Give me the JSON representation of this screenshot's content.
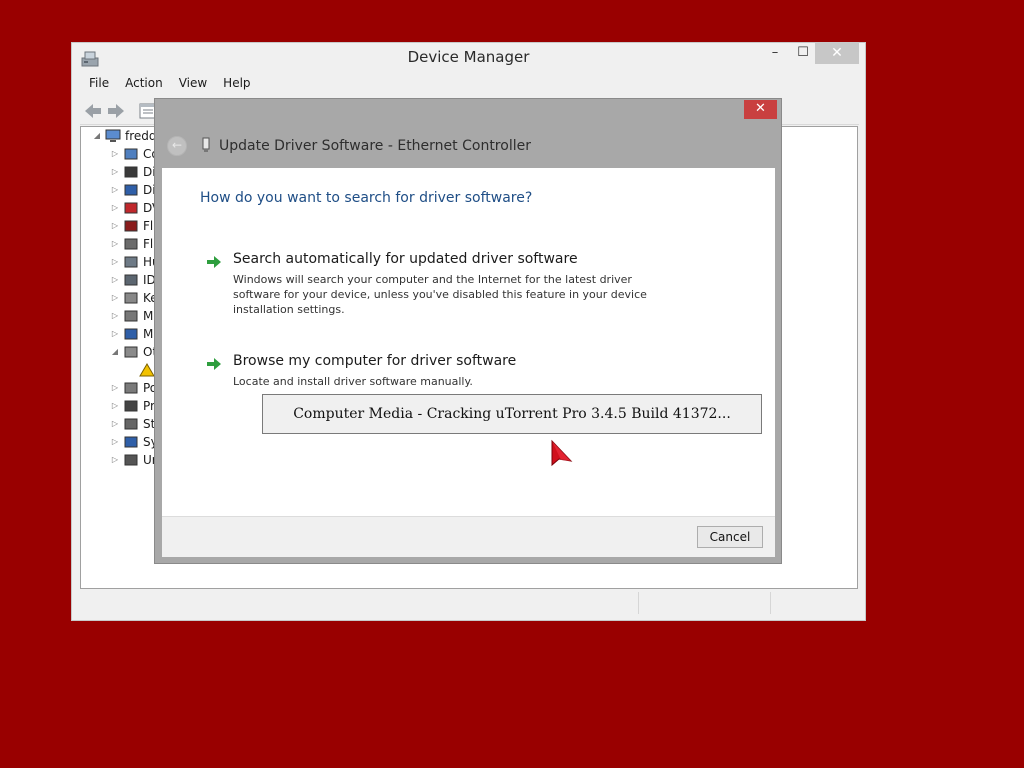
{
  "device_manager": {
    "title": "Device Manager",
    "window_buttons": {
      "minimize": "–",
      "maximize": "☐",
      "close": "✕"
    },
    "menu": [
      "File",
      "Action",
      "View",
      "Help"
    ],
    "tree": {
      "root": {
        "label": "fredd",
        "expanded": true
      },
      "items": [
        {
          "label": "Co",
          "icon": "computer-icon"
        },
        {
          "label": "Di",
          "icon": "disk-drive-icon"
        },
        {
          "label": "Di",
          "icon": "display-adapter-icon"
        },
        {
          "label": "DV",
          "icon": "dvd-drive-icon"
        },
        {
          "label": "Fl",
          "icon": "floppy-controller-icon"
        },
        {
          "label": "Fl",
          "icon": "floppy-drive-icon"
        },
        {
          "label": "Hu",
          "icon": "hid-icon"
        },
        {
          "label": "ID",
          "icon": "ide-controller-icon"
        },
        {
          "label": "Ke",
          "icon": "keyboard-icon"
        },
        {
          "label": "M",
          "icon": "mouse-icon"
        },
        {
          "label": "M",
          "icon": "monitor-icon"
        },
        {
          "label": "Ot",
          "icon": "other-devices-icon",
          "expanded": true
        },
        {
          "label": "",
          "icon": "unknown-device-icon",
          "child": true
        },
        {
          "label": "Po",
          "icon": "ports-icon"
        },
        {
          "label": "Pr",
          "icon": "processor-icon"
        },
        {
          "label": "St",
          "icon": "storage-controller-icon"
        },
        {
          "label": "Sy",
          "icon": "system-devices-icon"
        },
        {
          "label": "Ur",
          "icon": "usb-icon"
        }
      ]
    }
  },
  "wizard": {
    "close_label": "✕",
    "back_icon": "back-arrow-icon",
    "title": "Update Driver Software - Ethernet Controller",
    "question": "How do you want to search for driver software?",
    "options": [
      {
        "title": "Search automatically for updated driver software",
        "description": "Windows will search your computer and the Internet for the latest driver software for your device, unless you've disabled this feature in your device installation settings."
      },
      {
        "title": "Browse my computer for driver software",
        "description": "Locate and install driver software manually."
      }
    ],
    "overlay_text": "Computer Media - Cracking uTorrent Pro 3.4.5 Build 41372...",
    "cancel_label": "Cancel"
  },
  "colors": {
    "desktop": "#990000",
    "link_blue": "#1f4e86",
    "green_arrow": "#2e9e3e",
    "close_red": "#c94040"
  }
}
